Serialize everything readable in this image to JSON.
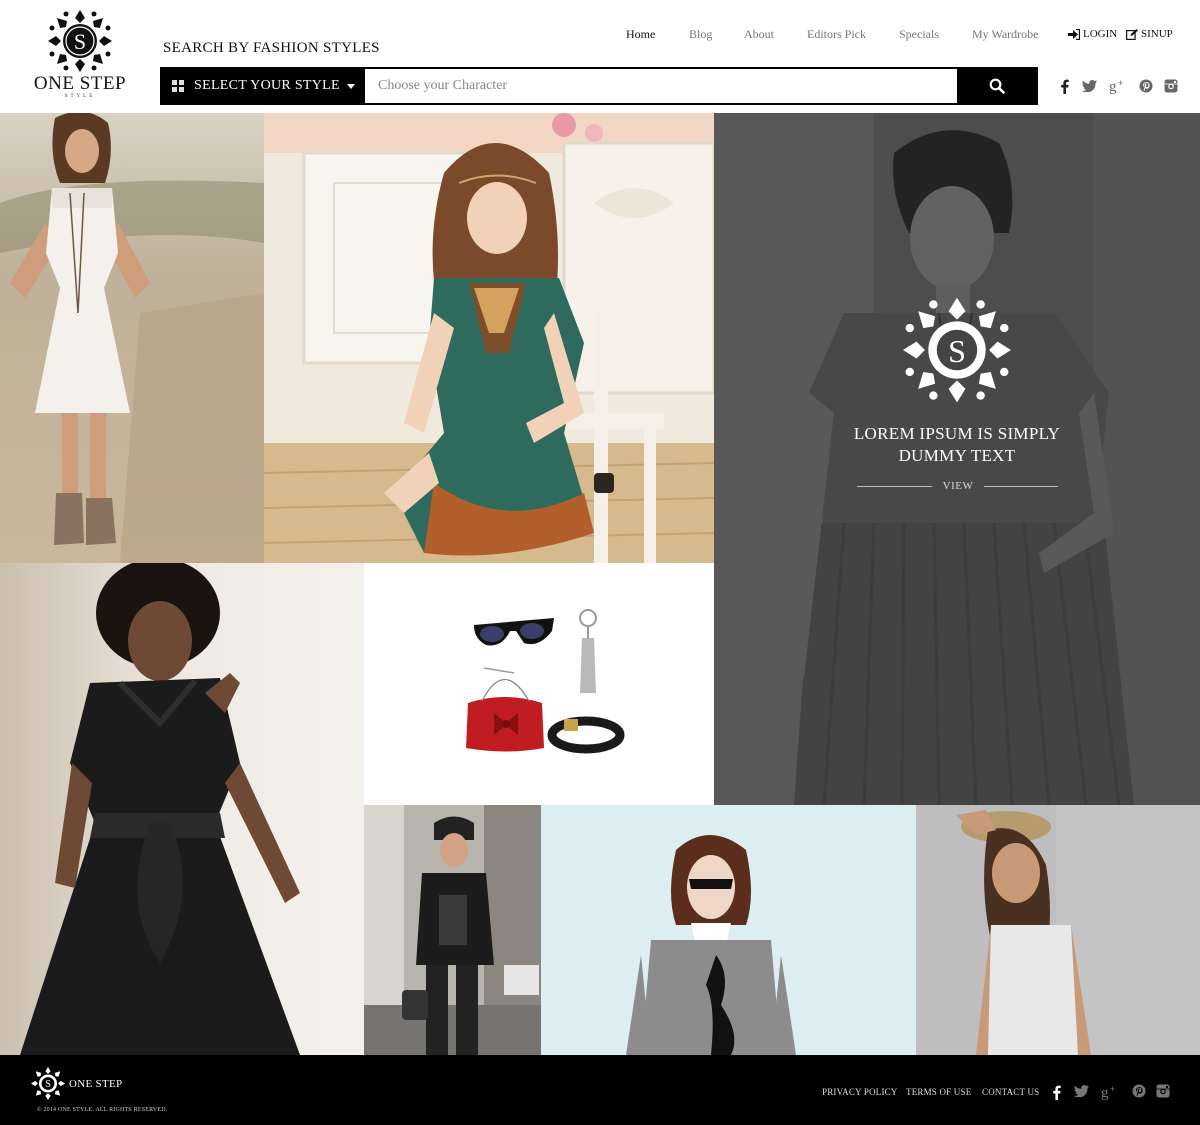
{
  "brand": {
    "initial": "S",
    "name": "ONE STEP",
    "tagline": "STYLE"
  },
  "search": {
    "title": "SEARCH BY  FASHION STYLES",
    "style_select_label": "SELECT YOUR STYLE",
    "placeholder": "Choose your Character",
    "button_icon": "search-icon"
  },
  "nav": {
    "items": [
      {
        "label": "Home",
        "active": true
      },
      {
        "label": "Blog",
        "active": false
      },
      {
        "label": "About",
        "active": false
      },
      {
        "label": "Editors Pick",
        "active": false
      },
      {
        "label": "Specials",
        "active": false
      },
      {
        "label": "My Wardrobe",
        "active": false
      }
    ],
    "login_label": "LOGIN",
    "signup_label": "SINUP"
  },
  "social": [
    "facebook-icon",
    "twitter-icon",
    "google-plus-icon",
    "pinterest-icon",
    "instagram-icon"
  ],
  "feature": {
    "title_line1": "LOREM IPSUM IS SIMPLY",
    "title_line2": "DUMMY TEXT",
    "view_label": "VIEW"
  },
  "footer": {
    "brand": "ONE STEP",
    "copyright": "© 2014 ONE STYLE. ALL RIGHTS RESERVED.",
    "links": [
      "PRIVACY POLICY",
      "TERMS OF USE",
      "CONTACT US"
    ]
  },
  "colors": {
    "accent": "#000000",
    "overlay": "#3a3a3a"
  }
}
